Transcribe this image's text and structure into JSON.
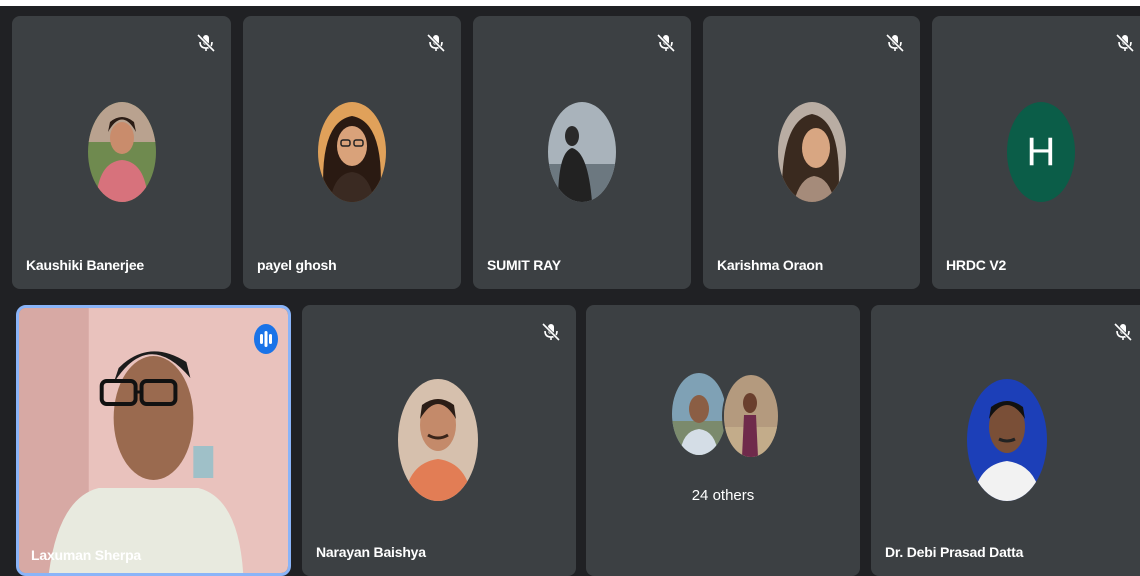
{
  "participants_top": [
    {
      "name": "Kaushiki Banerjee",
      "avatar_color": "#c9776f",
      "muted": true
    },
    {
      "name": "payel ghosh",
      "avatar_color": "#c0814a",
      "muted": true
    },
    {
      "name": "SUMIT RAY",
      "avatar_color": "#9aa4ad",
      "muted": true
    },
    {
      "name": "Karishma Oraon",
      "avatar_color": "#a78d76",
      "muted": true
    },
    {
      "name": "HRDC V2",
      "avatar_letter": "H",
      "avatar_color": "#0b5d48",
      "muted": true
    }
  ],
  "participants_bottom": [
    {
      "name": "Laxuman Sherpa",
      "video_on": true,
      "speaking": true
    },
    {
      "name": "Narayan Baishya",
      "avatar_color": "#d49a75",
      "muted": true
    },
    {
      "others_label": "24 others"
    },
    {
      "name": "Dr. Debi Prasad Datta",
      "avatar_color": "#1c3fb8",
      "muted": true
    }
  ],
  "colors": {
    "background": "#202124",
    "tile": "#3c4043",
    "active_border": "#8ab4f8",
    "speaking_badge": "#1a73e8"
  },
  "icons": {
    "muted": "mic-off-icon",
    "speaking": "audio-level-icon"
  }
}
